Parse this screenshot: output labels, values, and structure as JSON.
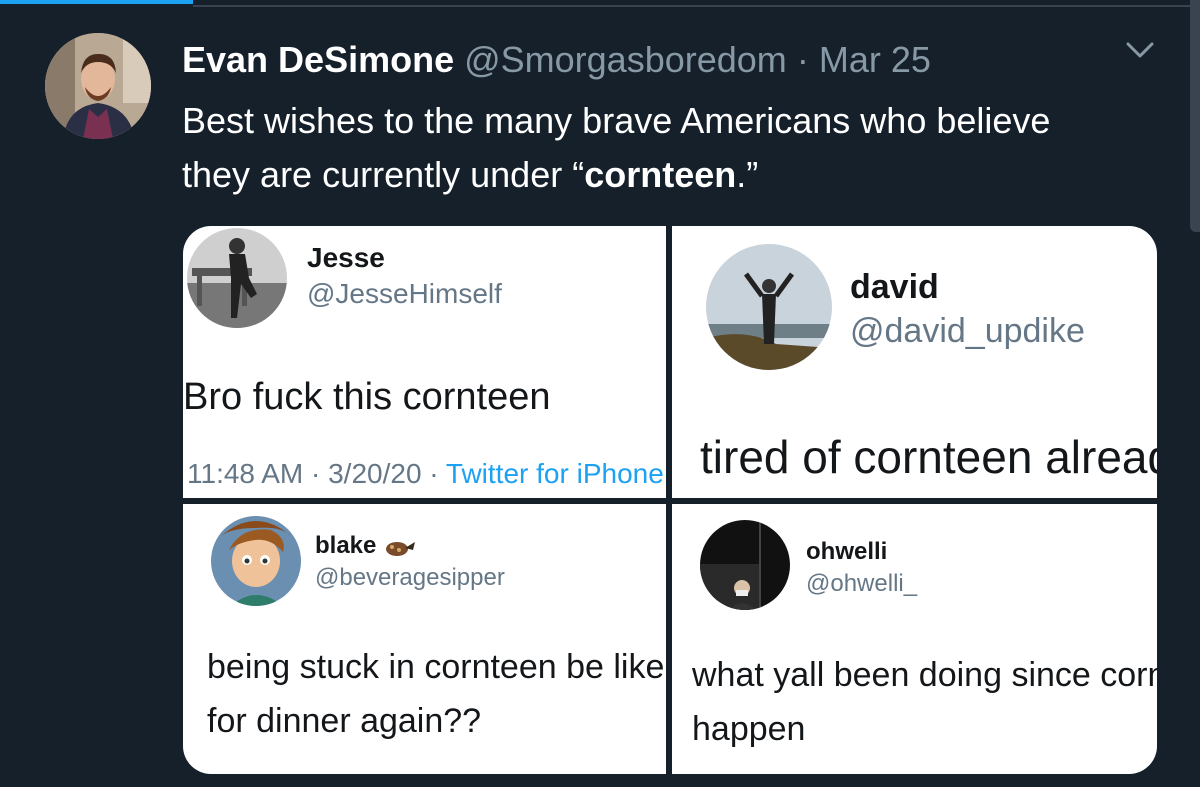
{
  "tweet": {
    "name": "Evan DeSimone",
    "handle": "@Smorgasboredom",
    "separator": "·",
    "date": "Mar 25",
    "text_part1": "Best wishes to the many brave Americans who believe they are currently under “",
    "text_bold": "cornteen",
    "text_part2": ".”"
  },
  "panels": [
    {
      "name": "Jesse",
      "handle": "@JesseHimself",
      "text": "Bro fuck this cornteen",
      "time": "11:48 AM · 3/20/20 · ",
      "source": "Twitter for iPhone"
    },
    {
      "name": "david",
      "handle": "@david_updike",
      "text": "tired of cornteen already"
    },
    {
      "name": "blake",
      "handle": "@beveragesipper",
      "text_line1": "being stuck in cornteen be like",
      "text_line2": "for dinner again??"
    },
    {
      "name": "ohwelli",
      "handle": "@ohwelli_",
      "text_line1": "what yall been doing since cornteen",
      "text_line2": "happen"
    }
  ],
  "colors": {
    "background": "#15202b",
    "accent": "#1da1f2",
    "muted": "#8899a6"
  }
}
